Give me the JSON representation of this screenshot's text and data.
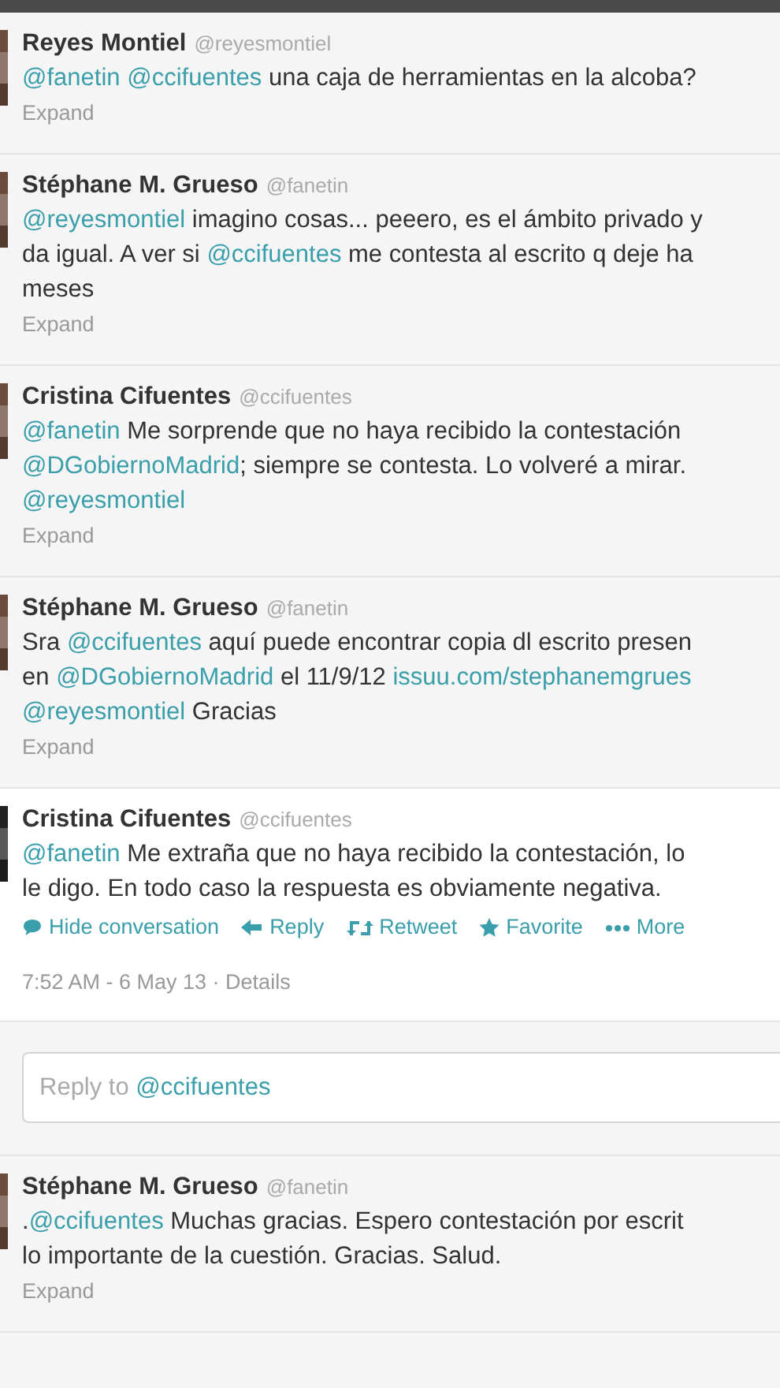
{
  "tweets": [
    {
      "kind": "collapsed",
      "name": "Reyes Montiel",
      "handle": "@reyesmontiel",
      "lines": [
        [
          {
            "kind": "mention",
            "text": "@fanetin"
          },
          {
            "kind": "mention",
            "text": "@ccifuentes"
          },
          {
            "kind": "text",
            "text": " una caja de herramientas en la alcoba?"
          }
        ]
      ],
      "expand": "Expand"
    },
    {
      "kind": "collapsed",
      "name": "Stéphane M. Grueso",
      "handle": "@fanetin",
      "lines": [
        [
          {
            "kind": "mention",
            "text": "@reyesmontiel"
          },
          {
            "kind": "text",
            "text": " imagino cosas... peeero, es el ámbito privado y"
          }
        ],
        [
          {
            "kind": "text",
            "text": "da igual. A ver si "
          },
          {
            "kind": "mention",
            "text": "@ccifuentes"
          },
          {
            "kind": "text",
            "text": " me contesta al escrito q deje ha"
          }
        ],
        [
          {
            "kind": "text",
            "text": "meses"
          }
        ]
      ],
      "expand": "Expand"
    },
    {
      "kind": "collapsed",
      "name": "Cristina Cifuentes",
      "handle": "@ccifuentes",
      "lines": [
        [
          {
            "kind": "mention",
            "text": "@fanetin"
          },
          {
            "kind": "text",
            "text": " Me sorprende que no haya recibido la contestación"
          }
        ],
        [
          {
            "kind": "mention",
            "text": "@DGobiernoMadrid"
          },
          {
            "kind": "text",
            "text": "; siempre se contesta. Lo volveré a mirar."
          }
        ],
        [
          {
            "kind": "mention",
            "text": "@reyesmontiel"
          }
        ]
      ],
      "expand": "Expand"
    },
    {
      "kind": "collapsed",
      "name": "Stéphane M. Grueso",
      "handle": "@fanetin",
      "lines": [
        [
          {
            "kind": "text",
            "text": "Sra "
          },
          {
            "kind": "mention",
            "text": "@ccifuentes"
          },
          {
            "kind": "text",
            "text": " aquí puede encontrar copia dl escrito presen"
          }
        ],
        [
          {
            "kind": "text",
            "text": "en "
          },
          {
            "kind": "mention",
            "text": "@DGobiernoMadrid"
          },
          {
            "kind": "text",
            "text": " el 11/9/12 "
          },
          {
            "kind": "mention",
            "text": "issuu.com/stephanemgrues"
          }
        ],
        [
          {
            "kind": "mention",
            "text": "@reyesmontiel"
          },
          {
            "kind": "text",
            "text": " Gracias"
          }
        ]
      ],
      "expand": "Expand"
    },
    {
      "kind": "expanded",
      "name": "Cristina Cifuentes",
      "handle": "@ccifuentes",
      "lines": [
        [
          {
            "kind": "mention",
            "text": "@fanetin"
          },
          {
            "kind": "text",
            "text": " Me extraña que no haya recibido la contestación, lo"
          }
        ],
        [
          {
            "kind": "text",
            "text": "le digo. En todo caso la respuesta es obviamente negativa."
          }
        ]
      ],
      "actions": [
        {
          "kind": "conversation",
          "label": "Hide conversation"
        },
        {
          "kind": "reply",
          "label": "Reply"
        },
        {
          "kind": "retweet",
          "label": "Retweet"
        },
        {
          "kind": "favorite",
          "label": "Favorite"
        },
        {
          "kind": "more",
          "label": "More"
        }
      ],
      "timestamp": "7:52 AM - 6 May 13 · Details",
      "reply_box": {
        "prompt": "Reply to ",
        "mention": "@ccifuentes"
      }
    },
    {
      "kind": "collapsed",
      "name": "Stéphane M. Grueso",
      "handle": "@fanetin",
      "lines": [
        [
          {
            "kind": "text",
            "text": "."
          },
          {
            "kind": "mention",
            "text": "@ccifuentes"
          },
          {
            "kind": "text",
            "text": " Muchas gracias. Espero contestación por escrit"
          }
        ],
        [
          {
            "kind": "text",
            "text": "lo importante de la cuestión. Gracias. Salud."
          }
        ]
      ],
      "expand": "Expand"
    }
  ]
}
